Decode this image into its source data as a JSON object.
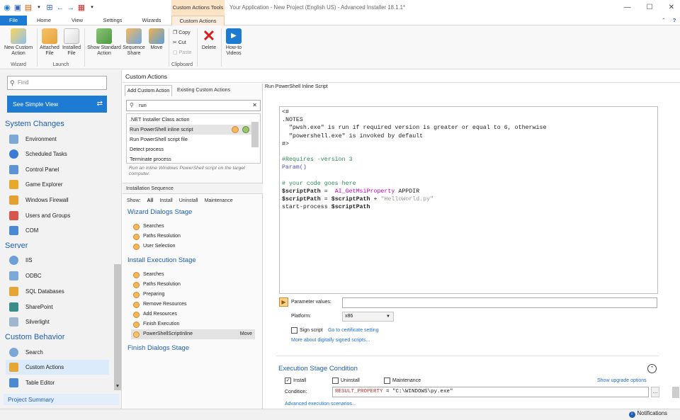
{
  "window": {
    "title": "Your Application - New Project (English US) - Advanced Installer 18.1.1*",
    "context_tab_title": "Custom Actions Tools",
    "controls": [
      "—",
      "☐",
      "✕"
    ]
  },
  "tabs": [
    "File",
    "Home",
    "View",
    "Settings",
    "Wizards",
    "Custom Actions"
  ],
  "ribbon": {
    "new_custom_action": "New Custom Action",
    "attached_file": "Attached File",
    "installed_file": "Installed File",
    "show_standard_action": "Show Standard Action",
    "sequence_share": "Sequence Share",
    "move": "Move",
    "copy": "Copy",
    "cut": "Cut",
    "paste": "Paste",
    "delete": "Delete",
    "how_to_videos": "How-to Videos",
    "group_wizard": "Wizard",
    "group_launch": "Launch",
    "group_clipboard": "Clipboard"
  },
  "sidebar": {
    "find_placeholder": "Find",
    "simple_view": "See Simple View",
    "sections": [
      {
        "title": "System Changes",
        "items": [
          "Environment",
          "Scheduled Tasks",
          "Control Panel",
          "Game Explorer",
          "Windows Firewall",
          "Users and Groups",
          "COM"
        ]
      },
      {
        "title": "Server",
        "items": [
          "IIS",
          "ODBC",
          "SQL Databases",
          "SharePoint",
          "Silverlight"
        ]
      },
      {
        "title": "Custom Behavior",
        "items": [
          "Search",
          "Custom Actions",
          "Table Editor"
        ]
      }
    ],
    "project_summary": "Project Summary"
  },
  "panel_header": "Custom Actions",
  "custom_actions": {
    "tab_add": "Add Custom Action",
    "tab_existing": "Existing Custom Actions",
    "search_value": "run",
    "list": [
      ".NET Installer Class action",
      "Run PowerShell inline script",
      "Run PowerShell script file",
      "Detect process",
      "Terminate process"
    ],
    "description": "Run an Inline Windows PowerShell script on the target computer."
  },
  "install_sequence": {
    "header": "Installation Sequence",
    "show_label": "Show:",
    "filters": [
      "All",
      "Install",
      "Uninstall",
      "Maintenance"
    ],
    "stages": [
      {
        "title": "Wizard Dialogs Stage",
        "steps": [
          "Searches",
          "Paths Resolution",
          "User Selection"
        ]
      },
      {
        "title": "Install Execution Stage",
        "steps": [
          "Searches",
          "Paths Resolution",
          "Preparing",
          "Remove Resources",
          "Add Resources",
          "Finish Execution",
          "PowerShellScriptInline"
        ]
      },
      {
        "title": "Finish Dialogs Stage",
        "steps": []
      }
    ],
    "move_label": "Move"
  },
  "script": {
    "header": "Run PowerShell Inline Script",
    "lines": [
      [
        {
          "t": "<#",
          "c": "def"
        }
      ],
      [
        {
          "t": ".NOTES",
          "c": "def"
        }
      ],
      [
        {
          "t": "  \"pwsh.exe\" is run if required version is greater or equal to 6, otherwise",
          "c": "def"
        }
      ],
      [
        {
          "t": "  \"powershell.exe\" is invoked by default",
          "c": "def"
        }
      ],
      [
        {
          "t": "#>",
          "c": "def"
        }
      ],
      [
        {
          "t": "",
          "c": "def"
        }
      ],
      [
        {
          "t": "#Requires -version 3",
          "c": "cmt"
        }
      ],
      [
        {
          "t": "Param()",
          "c": "kw"
        }
      ],
      [
        {
          "t": "",
          "c": "def"
        }
      ],
      [
        {
          "t": "# your code goes here",
          "c": "cmt"
        }
      ],
      [
        {
          "t": "$scriptPath",
          "c": "var"
        },
        {
          "t": " =  ",
          "c": "def"
        },
        {
          "t": "AI_GetMsiProperty",
          "c": "fn"
        },
        {
          "t": " APPDIR",
          "c": "def"
        }
      ],
      [
        {
          "t": "$scriptPath",
          "c": "var"
        },
        {
          "t": " = ",
          "c": "def"
        },
        {
          "t": "$scriptPath",
          "c": "var"
        },
        {
          "t": " + ",
          "c": "def"
        },
        {
          "t": "\"HelloWorld.py\"",
          "c": "str"
        }
      ],
      [
        {
          "t": "start-process ",
          "c": "def"
        },
        {
          "t": "$scriptPath",
          "c": "var"
        }
      ]
    ],
    "parameter_values_label": "Parameter values:",
    "platform_label": "Platform:",
    "platform_value": "x86",
    "sign_script": "Sign script",
    "goto_cert": "Go to certificate setting",
    "more_signed": "More about digitally signed scripts..."
  },
  "execution_condition": {
    "header": "Execution Stage Condition",
    "install": "Install",
    "install_checked": true,
    "uninstall": "Uninstall",
    "maintenance": "Maintenance",
    "show_upgrade": "Show upgrade options",
    "condition_label": "Condition:",
    "condition_prop": "RESULT_PROPERTY",
    "condition_rest": " = \"C:\\WINDOWS\\py.exe\"",
    "advanced": "Advanced execution scenarios..."
  },
  "status": {
    "notifications": "Notifications"
  },
  "colors": {
    "accent": "#1e7bd3",
    "context": "#fbe3c6",
    "link": "#1e6fce",
    "heading": "#1e5fb3"
  }
}
